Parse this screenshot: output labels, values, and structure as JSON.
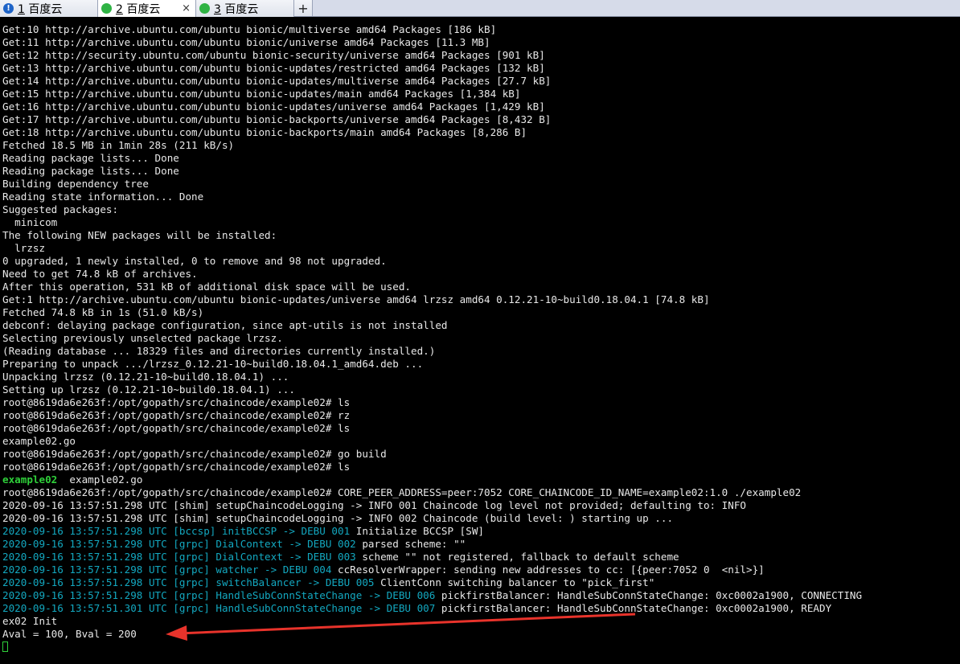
{
  "tabs": [
    {
      "number": "1",
      "label": "百度云",
      "indicator": "warning",
      "active": false
    },
    {
      "number": "2",
      "label": "百度云",
      "indicator": "green",
      "active": true,
      "close": "×"
    },
    {
      "number": "3",
      "label": "百度云",
      "indicator": "green",
      "active": false
    }
  ],
  "add_tab_label": "+",
  "colors": {
    "terminal_bg": "#000000",
    "text": "#e8e8e8",
    "cyan": "#13a8c0",
    "green": "#2fd03a",
    "arrow": "#e8332b"
  },
  "terminal": {
    "lines": [
      "Get:10 http://archive.ubuntu.com/ubuntu bionic/multiverse amd64 Packages [186 kB]",
      "Get:11 http://archive.ubuntu.com/ubuntu bionic/universe amd64 Packages [11.3 MB]",
      "Get:12 http://security.ubuntu.com/ubuntu bionic-security/universe amd64 Packages [901 kB]",
      "Get:13 http://archive.ubuntu.com/ubuntu bionic-updates/restricted amd64 Packages [132 kB]",
      "Get:14 http://archive.ubuntu.com/ubuntu bionic-updates/multiverse amd64 Packages [27.7 kB]",
      "Get:15 http://archive.ubuntu.com/ubuntu bionic-updates/main amd64 Packages [1,384 kB]",
      "Get:16 http://archive.ubuntu.com/ubuntu bionic-updates/universe amd64 Packages [1,429 kB]",
      "Get:17 http://archive.ubuntu.com/ubuntu bionic-backports/universe amd64 Packages [8,432 B]",
      "Get:18 http://archive.ubuntu.com/ubuntu bionic-backports/main amd64 Packages [8,286 B]",
      "Fetched 18.5 MB in 1min 28s (211 kB/s)",
      "Reading package lists... Done",
      "Reading package lists... Done",
      "Building dependency tree",
      "Reading state information... Done",
      "Suggested packages:",
      "  minicom",
      "The following NEW packages will be installed:",
      "  lrzsz",
      "0 upgraded, 1 newly installed, 0 to remove and 98 not upgraded.",
      "Need to get 74.8 kB of archives.",
      "After this operation, 531 kB of additional disk space will be used.",
      "Get:1 http://archive.ubuntu.com/ubuntu bionic-updates/universe amd64 lrzsz amd64 0.12.21-10~build0.18.04.1 [74.8 kB]",
      "Fetched 74.8 kB in 1s (51.0 kB/s)",
      "debconf: delaying package configuration, since apt-utils is not installed",
      "Selecting previously unselected package lrzsz.",
      "(Reading database ... 18329 files and directories currently installed.)",
      "Preparing to unpack .../lrzsz_0.12.21-10~build0.18.04.1_amd64.deb ...",
      "Unpacking lrzsz (0.12.21-10~build0.18.04.1) ...",
      "Setting up lrzsz (0.12.21-10~build0.18.04.1) ...",
      "root@8619da6e263f:/opt/gopath/src/chaincode/example02# ls",
      "root@8619da6e263f:/opt/gopath/src/chaincode/example02# rz",
      "root@8619da6e263f:/opt/gopath/src/chaincode/example02# ls",
      "example02.go",
      "root@8619da6e263f:/opt/gopath/src/chaincode/example02# go build",
      "root@8619da6e263f:/opt/gopath/src/chaincode/example02# ls"
    ],
    "ls_output": {
      "executable": "example02",
      "rest": "  example02.go"
    },
    "run_command": "root@8619da6e263f:/opt/gopath/src/chaincode/example02# CORE_PEER_ADDRESS=peer:7052 CORE_CHAINCODE_ID_NAME=example02:1.0 ./example02",
    "log_lines": [
      {
        "style": "white",
        "text": "2020-09-16 13:57:51.298 UTC [shim] setupChaincodeLogging -> INFO 001 Chaincode log level not provided; defaulting to: INFO"
      },
      {
        "style": "white",
        "text": "2020-09-16 13:57:51.298 UTC [shim] setupChaincodeLogging -> INFO 002 Chaincode (build level: ) starting up ..."
      },
      {
        "style": "cyan",
        "prefix": "2020-09-16 13:57:51.298 UTC [bccsp] initBCCSP -> DEBU 001",
        "text": " Initialize BCCSP [SW]"
      },
      {
        "style": "cyan",
        "prefix": "2020-09-16 13:57:51.298 UTC [grpc] DialContext -> DEBU 002",
        "text": " parsed scheme: \"\""
      },
      {
        "style": "cyan",
        "prefix": "2020-09-16 13:57:51.298 UTC [grpc] DialContext -> DEBU 003",
        "text": " scheme \"\" not registered, fallback to default scheme"
      },
      {
        "style": "cyan",
        "prefix": "2020-09-16 13:57:51.298 UTC [grpc] watcher -> DEBU 004",
        "text": " ccResolverWrapper: sending new addresses to cc: [{peer:7052 0  <nil>}]"
      },
      {
        "style": "cyan",
        "prefix": "2020-09-16 13:57:51.298 UTC [grpc] switchBalancer -> DEBU 005",
        "text": " ClientConn switching balancer to \"pick_first\""
      },
      {
        "style": "cyan",
        "prefix": "2020-09-16 13:57:51.298 UTC [grpc] HandleSubConnStateChange -> DEBU 006",
        "text": " pickfirstBalancer: HandleSubConnStateChange: 0xc0002a1900, CONNECTING"
      },
      {
        "style": "cyan",
        "prefix": "2020-09-16 13:57:51.301 UTC [grpc] HandleSubConnStateChange -> DEBU 007",
        "text": " pickfirstBalancer: HandleSubConnStateChange: 0xc0002a1900, READY"
      }
    ],
    "final_lines": [
      "ex02 Init",
      "Aval = 100, Bval = 200"
    ]
  }
}
